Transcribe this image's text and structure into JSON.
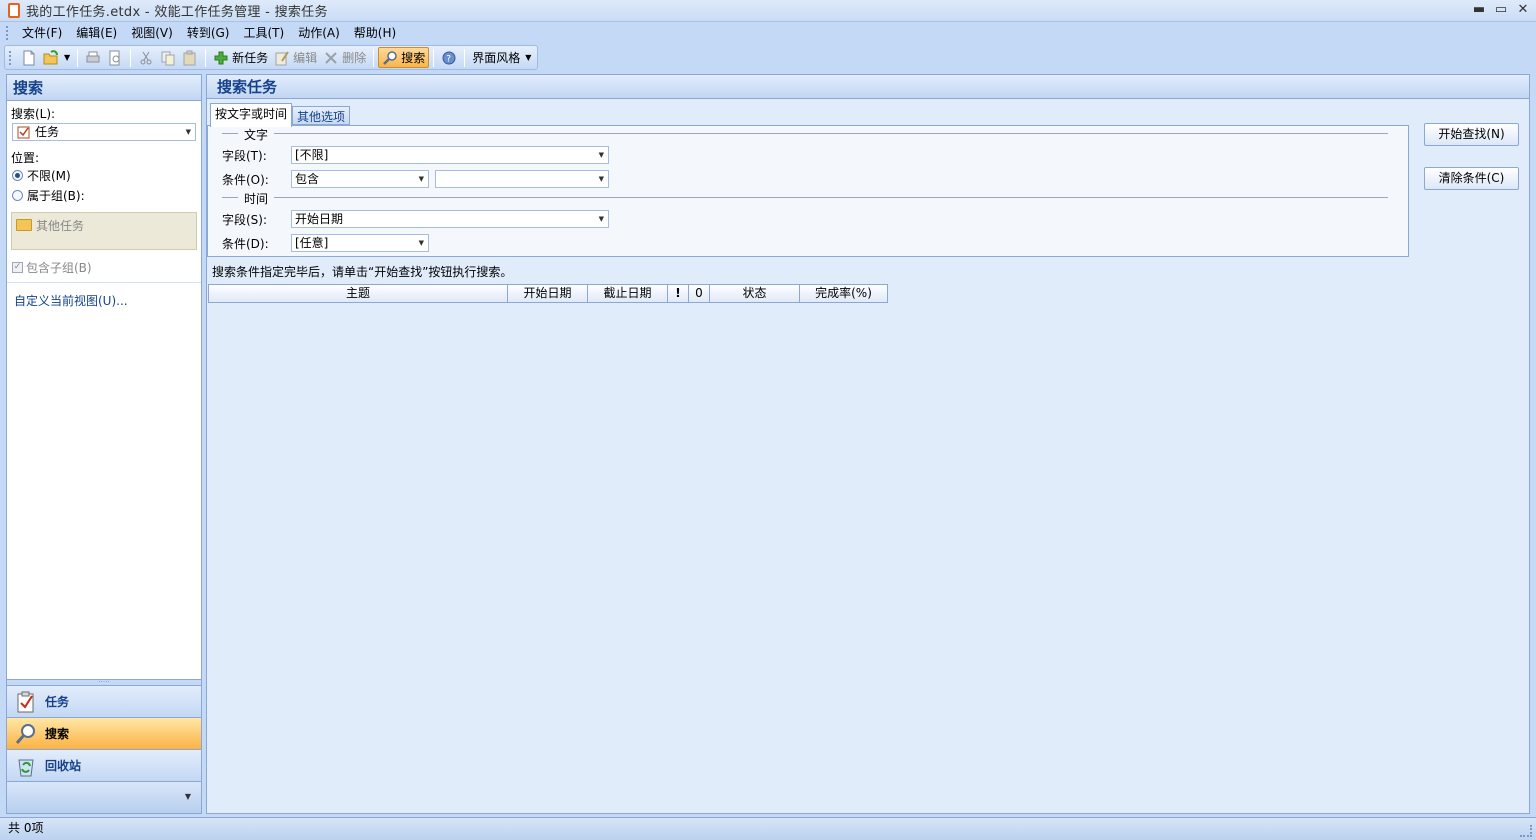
{
  "window": {
    "title": "我的工作任务.etdx - 效能工作任务管理 - 搜索任务",
    "min": "▬",
    "restore": "▭",
    "close": "✕"
  },
  "menu": [
    "文件(F)",
    "编辑(E)",
    "视图(V)",
    "转到(G)",
    "工具(T)",
    "动作(A)",
    "帮助(H)"
  ],
  "toolbar": {
    "new_task": "新任务",
    "edit": "编辑",
    "delete": "删除",
    "search": "搜索",
    "skin": "界面风格"
  },
  "left": {
    "header": "搜索",
    "search_label": "搜索(L):",
    "search_value": "任务",
    "location_label": "位置:",
    "radio_any": "不限(M)",
    "radio_group": "属于组(B):",
    "group_item": "其他任务",
    "include_sub": "包含子组(B)",
    "custom_view_link": "自定义当前视图(U)...",
    "nav": {
      "tasks": "任务",
      "search": "搜索",
      "recycle": "回收站"
    }
  },
  "main": {
    "header": "搜索任务",
    "tab_text_time": "按文字或时间",
    "tab_other": "其他选项",
    "section_text": "文字",
    "section_time": "时间",
    "field_label_t": "字段(T):",
    "cond_label_o": "条件(O):",
    "field_value_text": "[不限]",
    "cond_value_text": "包含",
    "cond_value_text2": "",
    "field_label_s": "字段(S):",
    "cond_label_d": "条件(D):",
    "field_value_time": "开始日期",
    "cond_value_time": "[任意]",
    "btn_start": "开始查找(N)",
    "btn_clear": "清除条件(C)",
    "hint": "搜索条件指定完毕后，请单击“开始查找”按钮执行搜索。",
    "columns": [
      "主题",
      "开始日期",
      "截止日期",
      "!",
      "0",
      "状态",
      "完成率(%)"
    ]
  },
  "status": {
    "count": "共 0项"
  }
}
